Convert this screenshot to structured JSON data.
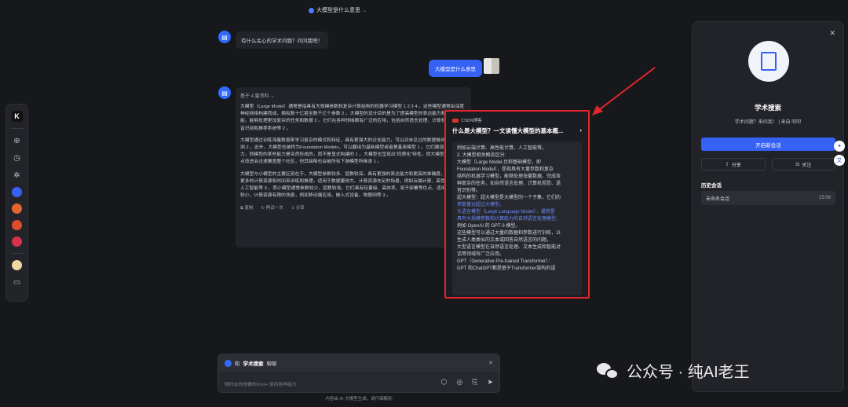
{
  "topbar": {
    "title": "大模型是什么意思"
  },
  "chat": {
    "greeting": "有什么关心的学术问题？问问我吧！",
    "user_message": "大模型是什么意思",
    "answer": {
      "meta": "基于 4 篇资料",
      "paragraphs": [
        "大模型（Large Model）通常是指具有大规模参数和复杂计算结构的机器学习模型 1 2 3 4 。这些模型通常由深度神经网络构建而成，拥有数十亿甚至数千亿个参数 2 。大模型的设计目的是为了提高模型的表达能力和预测性能，能够处理更加复杂的任务和数据 2 。它们在各种领域都有广泛的应用，包括自然语言处理、计算机视觉、语音识别和推荐系统等 2 。",
        "大模型通过训练海量数据来学习复杂的模式和特征，具有更强大的泛化能力，可以对未见过的数据做出准确的预测 2 。此外，大模型也被称为Foundation Models，可以翻译为基础模型或者是基座模型 1 。它们展现出\"涌现\"能力，即模型的某些能力是突然形成的，而不是显式构建的 1 。大模型也呈现出\"同质化\"特性，即大模型的任何一点改进会迅速覆盖整个社区，但其缺陷也会被所有下游模型所继承 1 。",
        "大模型与小模型的主要区别在于，大模型参数较多、层数较深，具有更强的表达能力和更高的准确度，但也需要更多的计算资源和时间来训练和推理，适用于数据量较大、计算资源充足的场景，例如云端计算、高性能计算、人工智能等 3 。而小模型通常参数较少、层数较浅，它们具有轻量级、高效率、易于部署等优点，适用于数据量较小、计算资源有限的场景，例如移动端应用、嵌入式设备、物联网等 3 。"
      ],
      "actions": {
        "copy": "复制",
        "regen": "再试一次",
        "share": "分享"
      }
    }
  },
  "popover": {
    "source": "CSDN博客",
    "title": "什么是大模型？一文读懂大模型的基本概...",
    "lines": [
      "例如云端计算、高性能计算、人工智能等。",
      "2. 大模型相关概念区分:",
      "大模型（Large Model,也称基础模型，即",
      "Foundation Model），是指具有大量参数和复杂",
      "结构的机器学习模型，能够处理海量数据、完成各",
      "种复杂的任务，如自然语言处理、计算机视觉、语",
      "音识别等。",
      "超大模型：超大模型是大模型的一个子集，它们的",
      "参数量远超过大模型。",
      "大语言模型（Large Language Model）：通常是",
      "具有大规模参数和计算能力的自然语言处理模型，",
      "例如 OpenAI 的 GPT-3 模型。",
      "这些模型可以通过大量的数据和参数进行训练，以",
      "生成人类类似的文本或回答自然语言的问题。",
      "大型语言模型在自然语言处理、文本生成和智能对",
      "话等领域有广泛应用。",
      "GPT（Generative Pre-trained Transformer）：",
      "GPT 和ChatGPT都是基于Transformer架构的语"
    ]
  },
  "composer": {
    "head_prefix": "和",
    "bot_name": "学术搜索",
    "head_suffix": "聊聊",
    "placeholder": "随时@你想要的Kimi+ 使用各种能力",
    "disclaimer": "内容由 AI 大模型生成，请仔细甄别"
  },
  "panel": {
    "title": "学术搜索",
    "subtitle": "学术问题？来问我！ | 来自 叩叩",
    "new_chat": "开启新会话",
    "share": "分享",
    "follow": "关注",
    "history_title": "历史会话",
    "history": [
      {
        "name": "未命名会话",
        "time": "15:09"
      }
    ]
  },
  "watermark": {
    "text": "公众号 · 纯AI老王"
  },
  "colors": {
    "accent": "#3561f5",
    "highlight_border": "#e3262b",
    "background": "#17181c"
  }
}
